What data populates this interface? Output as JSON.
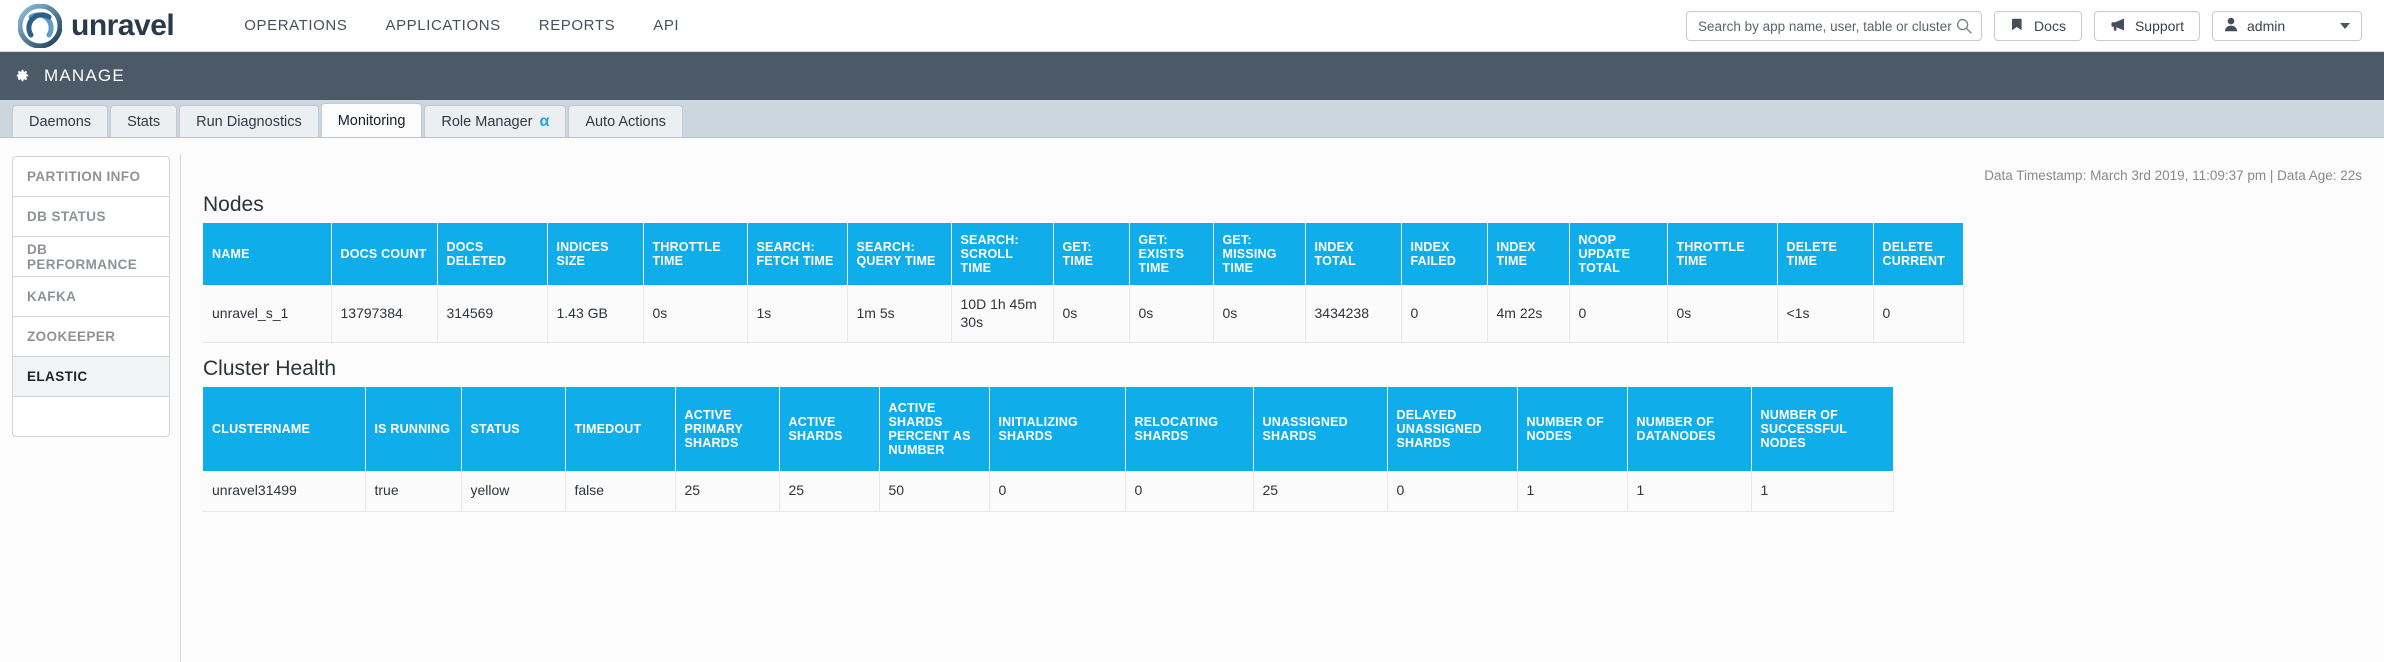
{
  "header": {
    "brand": "unravel",
    "menu": [
      "OPERATIONS",
      "APPLICATIONS",
      "REPORTS",
      "API"
    ],
    "search": {
      "placeholder": "Search by app name, user, table or cluster",
      "value": "",
      "icon": "search-icon"
    },
    "docs_label": "Docs",
    "support_label": "Support",
    "user_label": "admin"
  },
  "manage": {
    "title": "MANAGE",
    "icon": "gear-icon"
  },
  "tabs": [
    {
      "label": "Daemons",
      "active": false
    },
    {
      "label": "Stats",
      "active": false
    },
    {
      "label": "Run Diagnostics",
      "active": false
    },
    {
      "label": "Monitoring",
      "active": true
    },
    {
      "label": "Role Manager",
      "badge": "α",
      "active": false
    },
    {
      "label": "Auto Actions",
      "active": false
    }
  ],
  "sidebar": {
    "items": [
      {
        "label": "PARTITION INFO",
        "active": false
      },
      {
        "label": "DB STATUS",
        "active": false
      },
      {
        "label": "DB PERFORMANCE",
        "active": false
      },
      {
        "label": "KAFKA",
        "active": false
      },
      {
        "label": "ZOOKEEPER",
        "active": false
      },
      {
        "label": "ELASTIC",
        "active": true
      }
    ]
  },
  "main": {
    "timestamp": "Data Timestamp: March 3rd 2019, 11:09:37 pm | Data Age: 22s",
    "nodes": {
      "title": "Nodes",
      "columns": [
        "NAME",
        "DOCS COUNT",
        "DOCS DELETED",
        "INDICES SIZE",
        "THROTTLE TIME",
        "SEARCH: FETCH TIME",
        "SEARCH: QUERY TIME",
        "SEARCH: SCROLL TIME",
        "GET: TIME",
        "GET: EXISTS TIME",
        "GET: MISSING TIME",
        "INDEX TOTAL",
        "INDEX FAILED",
        "INDEX TIME",
        "NOOP UPDATE TOTAL",
        "THROTTLE TIME",
        "DELETE TIME",
        "DELETE CURRENT"
      ],
      "rows": [
        [
          "unravel_s_1",
          "13797384",
          "314569",
          "1.43 GB",
          "0s",
          "1s",
          "1m 5s",
          "10D 1h 45m 30s",
          "0s",
          "0s",
          "0s",
          "3434238",
          "0",
          "4m 22s",
          "0",
          "0s",
          "<1s",
          "0"
        ]
      ]
    },
    "cluster_health": {
      "title": "Cluster Health",
      "columns": [
        "CLUSTERNAME",
        "IS RUNNING",
        "STATUS",
        "TIMEDOUT",
        "ACTIVE PRIMARY SHARDS",
        "ACTIVE SHARDS",
        "ACTIVE SHARDS PERCENT AS NUMBER",
        "INITIALIZING SHARDS",
        "RELOCATING SHARDS",
        "UNASSIGNED SHARDS",
        "DELAYED UNASSIGNED SHARDS",
        "NUMBER OF NODES",
        "NUMBER OF DATANODES",
        "NUMBER OF SUCCESSFUL NODES"
      ],
      "rows": [
        [
          "unravel31499",
          "true",
          "yellow",
          "false",
          "25",
          "25",
          "50",
          "0",
          "0",
          "25",
          "0",
          "1",
          "1",
          "1"
        ]
      ]
    }
  },
  "colors": {
    "table_header_blue": "#0fadea",
    "manage_bar": "#4c5a68",
    "tab_strip": "#ccd6de",
    "accent": "#1fa7e0"
  }
}
